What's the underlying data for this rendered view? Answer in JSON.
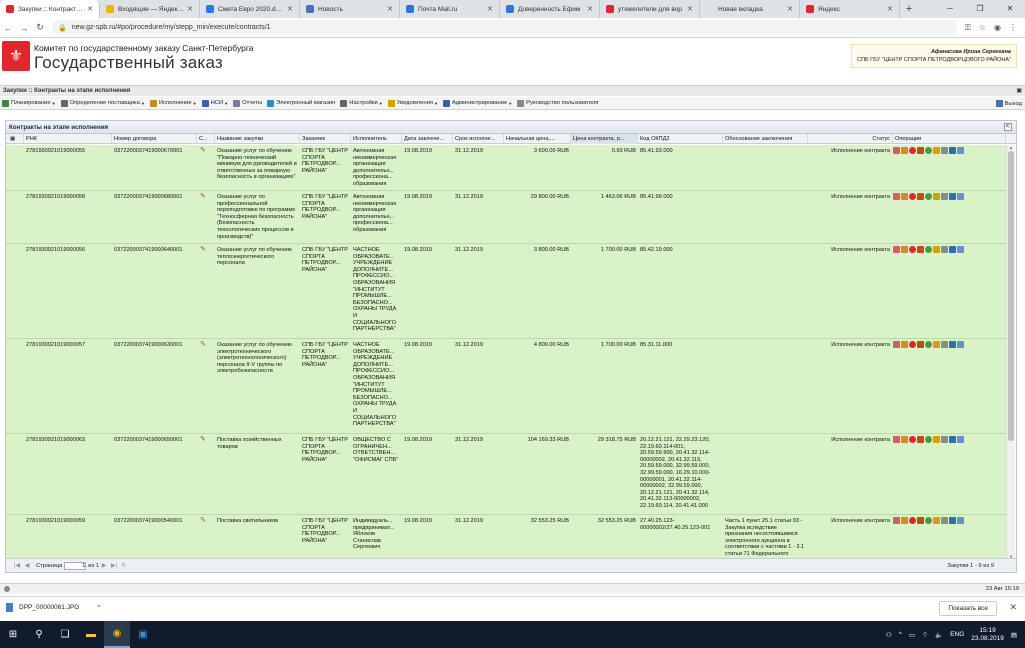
{
  "browser": {
    "tabs": [
      {
        "label": "Закупки :: Контракты на",
        "color": "#e2262e",
        "active": true
      },
      {
        "label": "Входящие — Яндекс.П",
        "color": "#f0b400",
        "active": false
      },
      {
        "label": "Смета Евро 2020.docx",
        "color": "#2b78e4",
        "active": false
      },
      {
        "label": "Новость",
        "color": "#4a6fb5",
        "active": false
      },
      {
        "label": "Почта Mail.ru",
        "color": "#2d73d8",
        "active": false
      },
      {
        "label": "Доверенность Ефим",
        "color": "#2b78e4",
        "active": false
      },
      {
        "label": "утяжелители для вор",
        "color": "#e2262e",
        "active": false
      },
      {
        "label": "Новая вкладка",
        "color": "#e0e0e0",
        "active": false
      },
      {
        "label": "Яндекс",
        "color": "#e2262e",
        "active": false
      }
    ],
    "url": "new.gz-spb.ru/#po/procedure/my/stepp_min/execute/contracts/1"
  },
  "header": {
    "org": "Комитет по государственному заказу Санкт-Петербурга",
    "title": "Государственный заказ",
    "user_name": "Афанасова Ирина Сергеевна",
    "user_org": "СПБ ГБУ \"ЦЕНТР СПОРТА ПЕТРОДВОРЦОВОГО РАЙОНА\""
  },
  "breadcrumb": "Закупки :: Контракты на этапе исполнения",
  "menu": [
    {
      "label": "Планирование",
      "caret": true,
      "color": "#3a8a3a"
    },
    {
      "label": "Определение поставщика",
      "caret": true,
      "color": "#666"
    },
    {
      "label": "Исполнение",
      "caret": true,
      "color": "#c48a2a"
    },
    {
      "label": "НСИ",
      "caret": true,
      "color": "#3a5fa5"
    },
    {
      "label": "Отчеты",
      "caret": false,
      "color": "#7a7aaa"
    },
    {
      "label": "Электронный магазин",
      "caret": false,
      "color": "#2c8bc4"
    },
    {
      "label": "Настройки",
      "caret": true,
      "color": "#666"
    },
    {
      "label": "Уведомления",
      "caret": true,
      "color": "#d6a000"
    },
    {
      "label": "Администрирование",
      "caret": true,
      "color": "#3a5fa5"
    },
    {
      "label": "Руководство пользователя",
      "caret": false,
      "color": "#888"
    }
  ],
  "exit_label": "Выход",
  "panel": {
    "title": "Контракты на этапе исполнения",
    "columns": [
      "РНК",
      "Номер договора",
      "С...",
      "Название закупки",
      "Заказчик",
      "Исполнитель",
      "Дата заключе...",
      "Срок исполне...",
      "Начальная цена,...",
      "Цена контракта, р...",
      "Код ОКПД2",
      "Обоснование заключения",
      "Статус",
      "Операции"
    ],
    "rows": [
      {
        "rnk": "2781930921019000055",
        "num": "0372200037419000670001",
        "name": "Оказание услуг по обучению \"Пожарно-технический минимум для руководителей и ответственных за пожарную безопасность в организациях\"",
        "customer": "СПБ ГБУ \"ЦЕНТР СПОРТА ПЕТРОДВОР... РАЙОНА\"",
        "executor": "Автономная некоммерческая организация дополнительн... профессиона... образования",
        "date": "19.08.2019",
        "term": "31.12.2019",
        "init_price": "3 600.00 RUB",
        "price": "0.93 RUB",
        "okpd": "85.41.93.000",
        "basis": "",
        "status": "Исполнение контракта"
      },
      {
        "rnk": "2781930921019000058",
        "num": "0372200037419000680001",
        "name": "Оказание услуг по профессиональной переподготовке по программе \"Техносферная безопасность (Безопасность технологических процессов и производств)\"",
        "customer": "СПБ ГБУ \"ЦЕНТР СПОРТА ПЕТРОДВОР... РАЙОНА\"",
        "executor": "Автономная некоммерческая организация дополнительн... профессиона... образования",
        "date": "19.08.2019",
        "term": "31.12.2019",
        "init_price": "29 800.00 RUB",
        "price": "1 463.06 RUB",
        "okpd": "85.41.99.000",
        "basis": "",
        "status": "Исполнение контракта"
      },
      {
        "rnk": "2781930921019000056",
        "num": "0372200037419000640001",
        "name": "Оказание услуг по обучению теплоэнергетического персонала",
        "customer": "СПБ ГБУ \"ЦЕНТР СПОРТА ПЕТРОДВОР... РАЙОНА\"",
        "executor": "ЧАСТНОЕ ОБРАЗОВАТЕ... УЧРЕЖДЕНИЕ ДОПОЛНИТЕ... ПРОФЕССИО... ОБРАЗОВАНИЯ \"ИНСТИТУТ ПРОМЫШЛЕ... БЕЗОПАСНО... ОХРАНЫ ТРУДА И СОЦИАЛЬНОГО ПАРТНЕРСТВА\"",
        "date": "19.08.2019",
        "term": "31.12.2019",
        "init_price": "3 800.00 RUB",
        "price": "1 700.00 RUB",
        "okpd": "85.42.19.000",
        "basis": "",
        "status": "Исполнение контракта"
      },
      {
        "rnk": "2781930921019000057",
        "num": "0372200037419000630001",
        "name": "Оказание услуг по обучению электротехнического (электротехнологического) персонала II-V группы по электробезопасности",
        "customer": "СПБ ГБУ \"ЦЕНТР СПОРТА ПЕТРОДВОР... РАЙОНА\"",
        "executor": "ЧАСТНОЕ ОБРАЗОВАТЕ... УЧРЕЖДЕНИЕ ДОПОЛНИТЕ... ПРОФЕССИО... ОБРАЗОВАНИЯ \"ИНСТИТУТ ПРОМЫШЛЕ... БЕЗОПАСНО... ОХРАНЫ ТРУДА И СОЦИАЛЬНОГО ПАРТНЕРСТВА\"",
        "date": "19.08.2019",
        "term": "31.12.2019",
        "init_price": "4 800.00 RUB",
        "price": "1 700.00 RUB",
        "okpd": "85.31.11.000",
        "basis": "",
        "status": "Исполнение контракта"
      },
      {
        "rnk": "2781930921019000063",
        "num": "0372200037419000650001",
        "name": "Поставка хозяйственных товаров",
        "customer": "СПБ ГБУ \"ЦЕНТР СПОРТА ПЕТРОДВОР... РАЙОНА\"",
        "executor": "ОБЩЕСТВО С ОГРАНИЧЕН... ОТВЕТСТВЕН... \"ОФИСМАГ СПБ\"",
        "date": "19.08.2019",
        "term": "31.12.2019",
        "init_price": "104 169.33 RUB",
        "price": "29 318.75 RUB",
        "okpd": "20.12.21.121, 22.29.23.120, 22.19.60.114-001, 20.59.59.900, 20.41.32.114-00000002, 20.41.32.119, 20.59.59.000, 32.99.59.000, 32.99.59.000, 16.29.10.000-00000001, 20.41.32.114-00000002, 32.99.59.000, 20.12.21.121, 20.41.32.114, 20.41.32.113-00000002, 22.19.60.114, 20.41.41.000",
        "basis": "",
        "status": "Исполнение контракта"
      },
      {
        "rnk": "2781930921019000059",
        "num": "0372200037419000540001",
        "name": "Поставка светильников",
        "customer": "СПБ ГБУ \"ЦЕНТР СПОРТА ПЕТРОДВОР... РАЙОНА\"",
        "executor": "Индивидуаль... предпринимат... Яблоков Станислав Сергеевич",
        "date": "19.08.2019",
        "term": "31.12.2019",
        "init_price": "32 553.25 RUB",
        "price": "32 553.25 RUB",
        "okpd": "27.40.25.123-00000002/27.40.25.123-001",
        "basis": "Часть 1 пункт 25.1 статьи 93 - Закупка вследствие признания несостоявшимся электронного аукциона в соответствии с частями 1 - 3.1 статьи 71 Федерального",
        "status": "Исполнение контракта"
      }
    ],
    "pager": {
      "page_label": "Страница",
      "page": "1",
      "of_label": "из 1",
      "count": "Закупки 1 - 9 из 9"
    }
  },
  "status_date": "23 Авг 15:19",
  "download": {
    "file": "DPP_00000061.JPG",
    "show_all": "Показать все"
  },
  "taskbar": {
    "lang": "ENG",
    "time": "15:19",
    "date": "23.08.2019"
  }
}
